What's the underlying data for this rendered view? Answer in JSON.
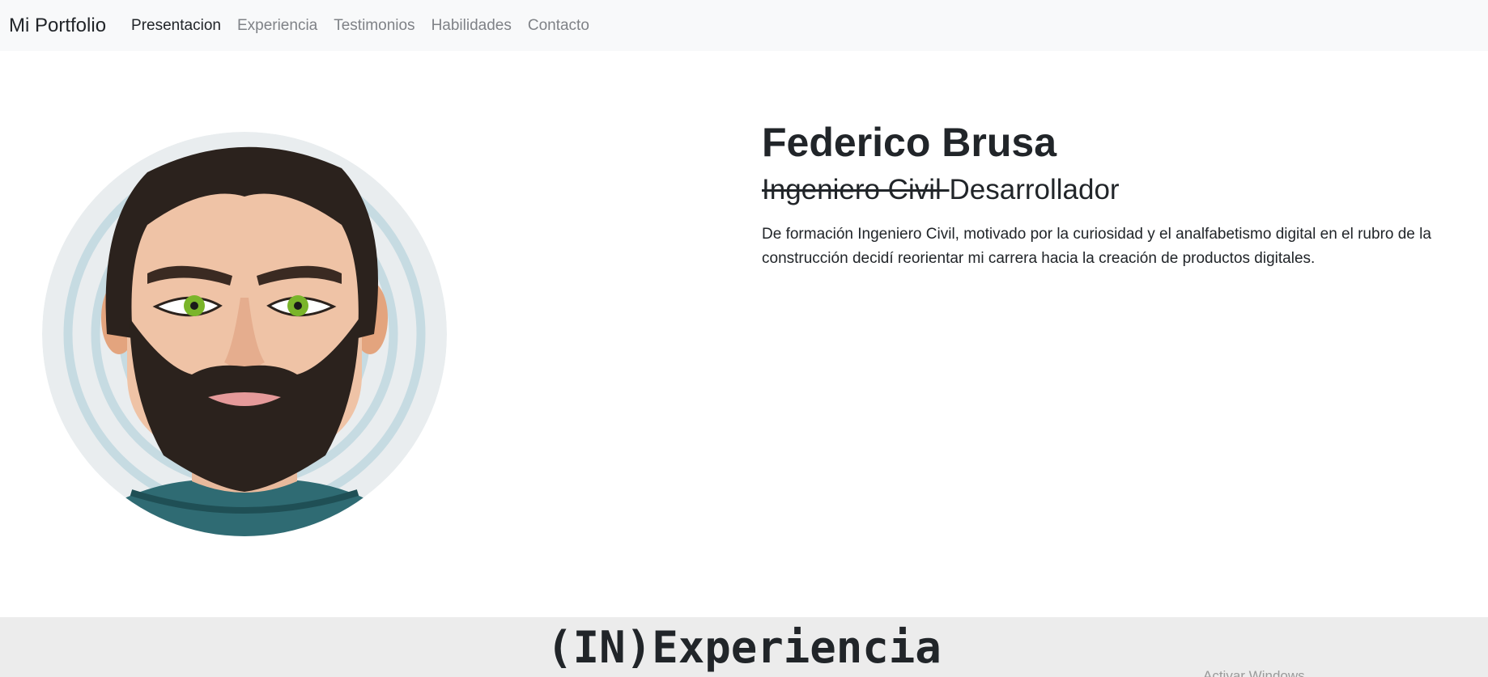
{
  "navbar": {
    "brand": "Mi Portfolio",
    "links": [
      {
        "label": "Presentacion",
        "active": true
      },
      {
        "label": "Experiencia",
        "active": false
      },
      {
        "label": "Testimonios",
        "active": false
      },
      {
        "label": "Habilidades",
        "active": false
      },
      {
        "label": "Contacto",
        "active": false
      }
    ]
  },
  "hero": {
    "name": "Federico Brusa",
    "role_struck": "Ingeniero Civil ",
    "role_current": "Desarrollador",
    "bio": "De formación Ingeniero Civil, motivado por la curiosidad y el analfabetismo digital en el rubro de la construcción decidí reorientar mi carrera hacia la creación de productos digitales."
  },
  "experience": {
    "title": "(IN)Experiencia"
  },
  "overlay": {
    "watermark": "Activar Windows"
  },
  "colors": {
    "navbar_bg": "#f8f9fa",
    "nav_inactive": "#7f8287",
    "text": "#212529",
    "band_bg": "#ececec",
    "beard": "#2b221d",
    "eyes": "#7ab52a",
    "shirt": "#2f6b73"
  },
  "icons": {
    "avatar": "bearded-man-avatar"
  }
}
